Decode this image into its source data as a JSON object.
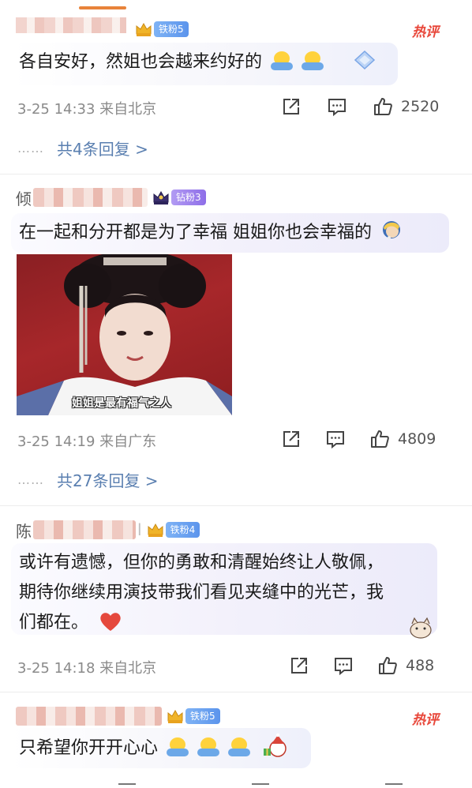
{
  "comments": [
    {
      "fan_badge": "铁粉5",
      "hot_label": "热评",
      "text": "各自安好，然姐也会越来约好的",
      "time": "3-25 14:33 来自北京",
      "likes": "2520",
      "reply_label": "共4条回复 >"
    },
    {
      "name_prefix": "倾",
      "fan_badge": "钻粉3",
      "text": "在一起和分开都是为了幸福 姐姐你也会幸福的",
      "image_caption": "姐姐是最有福气之人",
      "time": "3-25 14:19 来自广东",
      "likes": "4809",
      "reply_label": "共27条回复 >"
    },
    {
      "name_prefix": "陈",
      "name_suffix": "l",
      "fan_badge": "铁粉4",
      "text_lines": [
        "或许有遗憾，但你的勇敢和清醒始终让人敬佩，",
        "期待你继续用演技带我们看见夹缝中的光芒，我",
        "们都在。"
      ],
      "time": "3-25 14:18 来自北京",
      "likes": "488"
    },
    {
      "fan_badge": "铁粉5",
      "hot_label": "热评",
      "text": "只希望你开开心心"
    }
  ],
  "reply_dots": "……",
  "icons": {
    "share": "share-icon",
    "comment": "comment-icon",
    "like": "thumbs-up-icon",
    "crown": "crown-icon",
    "heart": "heart-icon",
    "emoji": "hug-emoji-icon"
  },
  "colors": {
    "hot": "#e8473a",
    "reply_link": "#5a7fb0",
    "meta": "#8a8a8a"
  }
}
